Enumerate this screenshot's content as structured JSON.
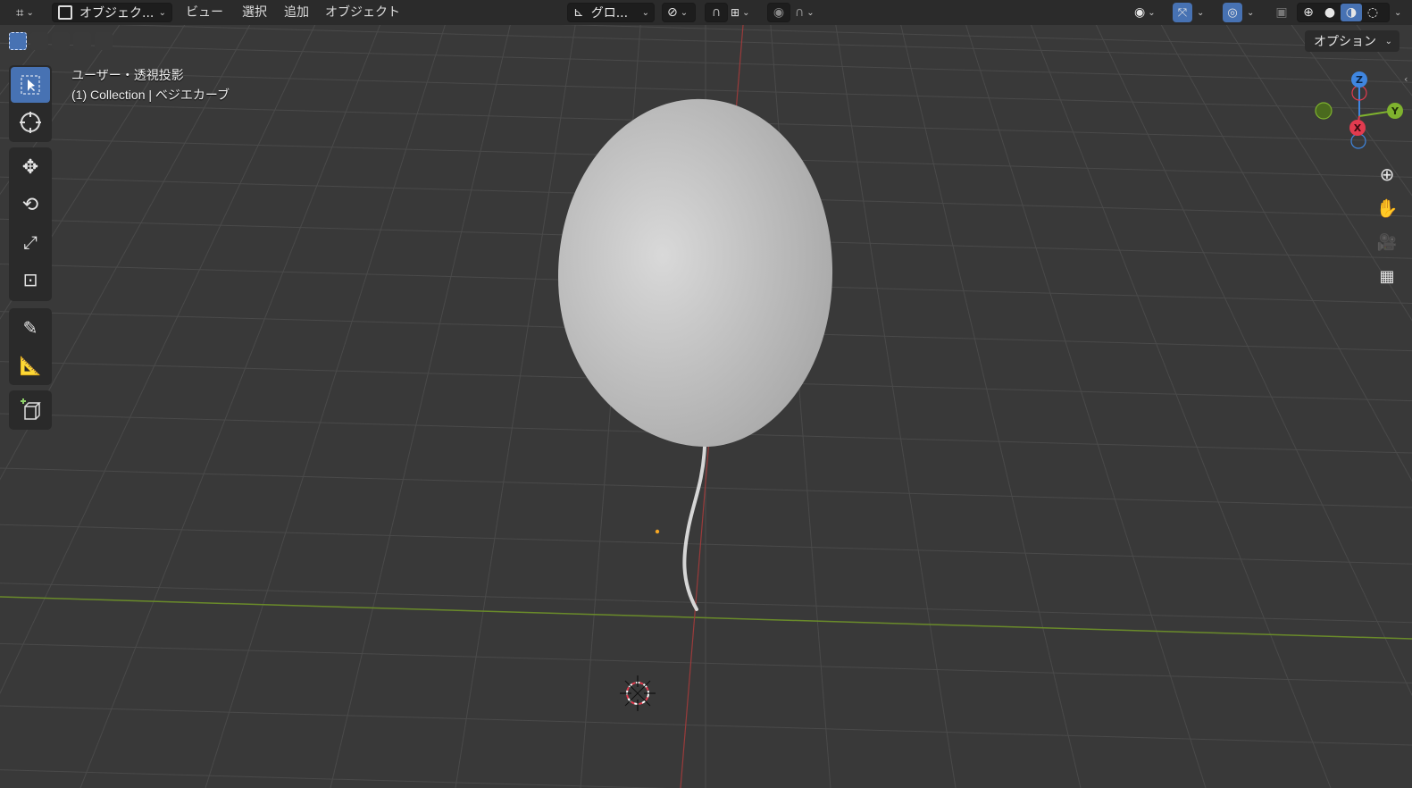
{
  "header": {
    "editor_type_icon": "3d-viewport-icon",
    "mode_label": "オブジェク...",
    "menus": [
      "ビュー",
      "選択",
      "追加",
      "オブジェクト"
    ],
    "transform_orientation": "グロ...",
    "options_label": "オプション"
  },
  "overlay": {
    "view_name": "ユーザー・透視投影",
    "collection_info": "(1) Collection | ベジエカーブ"
  },
  "gizmo": {
    "z_label": "Z",
    "y_label": "Y",
    "x_label": "X"
  },
  "colors": {
    "accent": "#4772b3",
    "x_axis": "#e23b4f",
    "y_axis": "#7fb32e",
    "z_axis": "#3f86e0",
    "origin": "#f5a623"
  },
  "toolbar": [
    {
      "name": "select-box-tool",
      "icon": "select-cursor-icon",
      "active": true
    },
    {
      "name": "cursor-tool",
      "icon": "3d-cursor-icon",
      "active": false
    },
    {
      "name": "move-tool",
      "icon": "move-arrows-icon",
      "active": false
    },
    {
      "name": "rotate-tool",
      "icon": "rotate-icon",
      "active": false
    },
    {
      "name": "scale-tool",
      "icon": "scale-icon",
      "active": false
    },
    {
      "name": "transform-tool",
      "icon": "transform-icon",
      "active": false
    },
    {
      "name": "annotate-tool",
      "icon": "annotate-pencil-icon",
      "active": false
    },
    {
      "name": "measure-tool",
      "icon": "ruler-icon",
      "active": false
    },
    {
      "name": "add-cube-tool",
      "icon": "add-cube-icon",
      "active": false
    }
  ]
}
